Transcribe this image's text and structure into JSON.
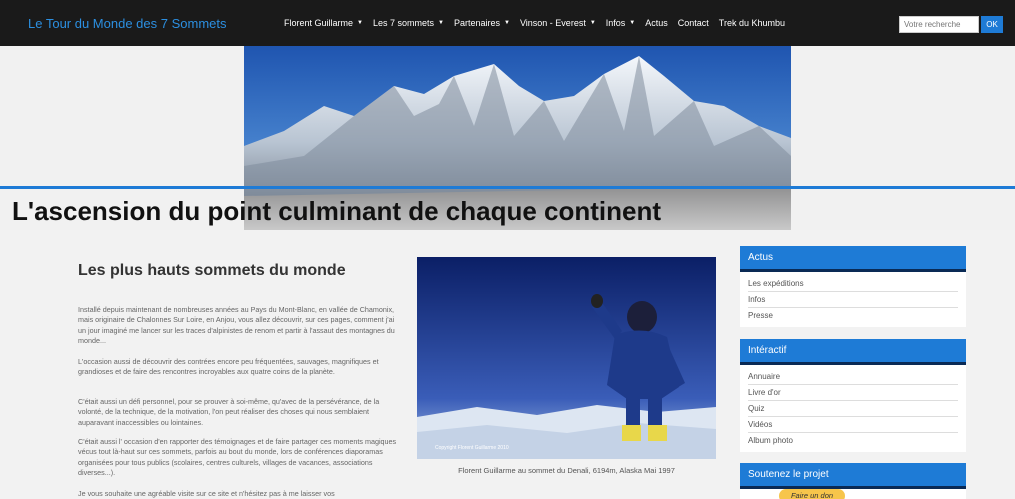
{
  "navbar": {
    "brand": "Le Tour du Monde des 7 Sommets",
    "items": [
      {
        "label": "Florent Guillarme",
        "dropdown": true
      },
      {
        "label": "Les 7 sommets",
        "dropdown": true
      },
      {
        "label": "Partenaires",
        "dropdown": true
      },
      {
        "label": "Vinson - Everest",
        "dropdown": true
      },
      {
        "label": "Infos",
        "dropdown": true
      },
      {
        "label": "Actus",
        "dropdown": false
      },
      {
        "label": "Contact",
        "dropdown": false
      },
      {
        "label": "Trek du Khumbu",
        "dropdown": false
      }
    ],
    "search_placeholder": "Votre recherche",
    "search_button": "OK"
  },
  "banner": {
    "headline": "L'ascension du point culminant de chaque continent"
  },
  "main": {
    "title": "Les plus hauts sommets du monde",
    "paragraphs": [
      "Installé depuis maintenant de nombreuses années au Pays du Mont-Blanc, en vallée de Chamonix, mais originaire de Chalonnes Sur Loire, en Anjou, vous allez découvrir, sur ces pages, comment j'ai un jour imaginé me lancer sur les traces d'alpinistes de renom et partir à l'assaut des montagnes du monde...",
      "L'occasion aussi de découvrir des contrées encore peu fréquentées, sauvages, magnifiques et grandioses et de faire des rencontres incroyables aux quatre coins de la planète.",
      "C'était aussi un défi personnel, pour se prouver à soi-même, qu'avec de la persévérance, de la volonté, de la technique, de la motivation, l'on peut réaliser des choses qui nous semblaient auparavant inaccessibles ou lointaines.",
      "C'était aussi l' occasion d'en rapporter des témoignages et de faire partager ces moments magiques vécus tout là-haut sur ces sommets, parfois au bout du monde, lors de conférences diaporamas organisées pour tous publics (scolaires, centres culturels, villages de vacances, associations diverses...).",
      "Je vous souhaite une agréable visite sur ce site et n'hésitez pas à me laisser vos"
    ],
    "photo_watermark": "Copyright Florent Guillarme 2010",
    "photo_caption": "Florent Guillarme au sommet du Denali, 6194m, Alaska Mai 1997"
  },
  "sidebar": {
    "actus": {
      "title": "Actus",
      "items": [
        "Les expéditions",
        "Infos",
        "Presse"
      ]
    },
    "interactif": {
      "title": "Intéractif",
      "items": [
        "Annuaire",
        "Livre d'or",
        "Quiz",
        "Vidéos",
        "Album photo"
      ]
    },
    "soutenez": {
      "title": "Soutenez le projet",
      "button": "Faire un don"
    }
  }
}
